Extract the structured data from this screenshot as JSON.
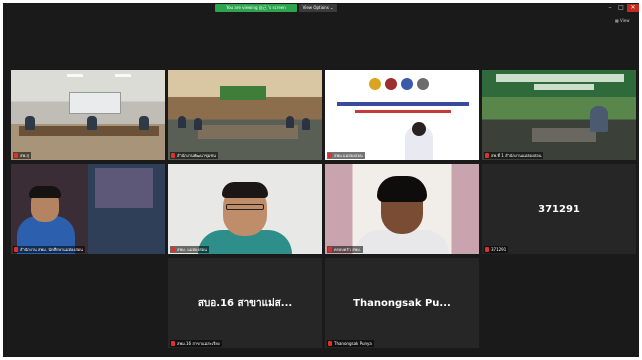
{
  "topbar": {
    "share_notice": "You are viewing 自己 's screen",
    "view_options": "View Options ⌄",
    "view_button": "▦ View"
  },
  "participants": [
    {
      "id": "p1",
      "label": "สพ.สุ",
      "muted": true
    },
    {
      "id": "p2",
      "label": "สำนักงานพัฒนาชุมชน",
      "muted": true
    },
    {
      "id": "p3",
      "label": "สพม.แม่ฮ่องสอน",
      "muted": true
    },
    {
      "id": "p4",
      "label": "สพ.ที่ 1 สำนักงานแม่ฮ่องสอน",
      "muted": true
    },
    {
      "id": "p5",
      "label": "สำนักงาน สพม. นักศึกษาแม่ฮ่องสอน",
      "muted": true
    },
    {
      "id": "p6",
      "label": "สพม. แม่ฮ่องสอน",
      "muted": true
    },
    {
      "id": "p7",
      "label": "ครอบครัว สพม.",
      "muted": true
    },
    {
      "id": "p8",
      "label": "371291",
      "muted": true,
      "display_name": "371291"
    },
    {
      "id": "p9",
      "label": "สพม.16 สาขาแม่สะเรียง",
      "muted": true,
      "display_name": "สบอ.16 สาขาแม่ส..."
    },
    {
      "id": "p10",
      "label": "Thanongsak Punya",
      "muted": true,
      "display_name": "Thanongsak  Pu..."
    }
  ]
}
